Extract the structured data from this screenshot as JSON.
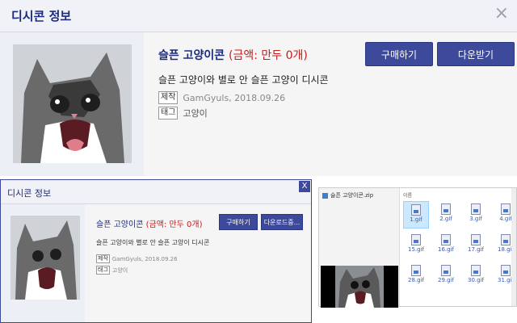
{
  "main": {
    "header_title": "디시콘 정보",
    "close_glyph": "×",
    "title_name": "슬픈 고양이콘",
    "title_price": "(금액: 만두 0개)",
    "buy_label": "구매하기",
    "download_label": "다운받기",
    "description": "슬픈 고양이와 별로 안 슬픈 고양이 디시콘",
    "maker_label": "제작",
    "maker_value": "GamGyuls, 2018.09.26",
    "tag_label": "태그",
    "tag_value": "고양이"
  },
  "inner": {
    "header_title": "디시콘 정보",
    "close_glyph": "X",
    "title_name": "슬픈 고양이콘",
    "title_price": "(금액: 만두 0개)",
    "buy_label": "구매하기",
    "download_label": "다운로드중...",
    "description": "슬픈 고양이와 별로 안 슬픈 고양이 디시콘",
    "maker_label": "제작",
    "maker_value": "GamGyuls, 2018.09.26",
    "tag_label": "태그",
    "tag_value": "고양이"
  },
  "explorer": {
    "zip_name": "슬픈 고양이콘.zip",
    "column_header": "이름",
    "files": [
      "1.gif",
      "2.gif",
      "3.gif",
      "4.gif",
      "15.gif",
      "16.gif",
      "17.gif",
      "18.gif",
      "28.gif",
      "29.gif",
      "30.gif",
      "31.gif"
    ],
    "selected_file": "1.gif"
  },
  "colors": {
    "accent": "#3d4a9c",
    "title": "#1d2a7a",
    "price": "#c21d1d"
  }
}
